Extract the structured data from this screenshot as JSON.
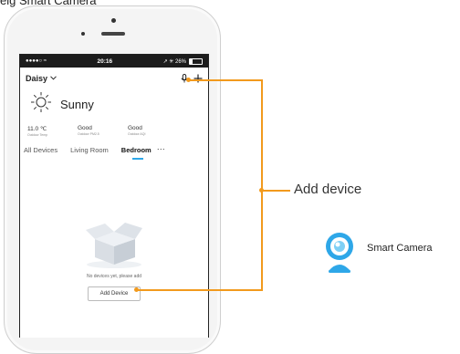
{
  "page_caption": "eig Smart Camera",
  "status": {
    "carrier": "●●●●○ ≈",
    "time": "20:16",
    "right": "↗ ✳ 26%",
    "battery_level": 0.26
  },
  "header": {
    "home_name": "Daisy",
    "chevron_icon": "chevron-down-icon",
    "mic_icon": "microphone-icon",
    "add_icon": "plus-icon"
  },
  "weather": {
    "icon": "sun-icon",
    "condition": "Sunny"
  },
  "metrics": [
    {
      "value": "11.0 ℃",
      "label": "Outdoor Temp"
    },
    {
      "value": "Good",
      "label": "Outdoor PM2.5"
    },
    {
      "value": "Good",
      "label": "Outdoor AQI"
    }
  ],
  "tabs": [
    {
      "label": "All Devices",
      "active": false
    },
    {
      "label": "Living Room",
      "active": false
    },
    {
      "label": "Bedroom",
      "active": true
    }
  ],
  "more_icon": "more-horizontal-icon",
  "empty_state": {
    "icon": "empty-box-icon",
    "text": "No devices yet, please add",
    "button_label": "Add Device"
  },
  "callout": {
    "label": "Add device",
    "color": "#f29a1d"
  },
  "accessory": {
    "icon": "smart-camera-icon",
    "label": "Smart Camera",
    "accent": "#2ea7e8"
  }
}
